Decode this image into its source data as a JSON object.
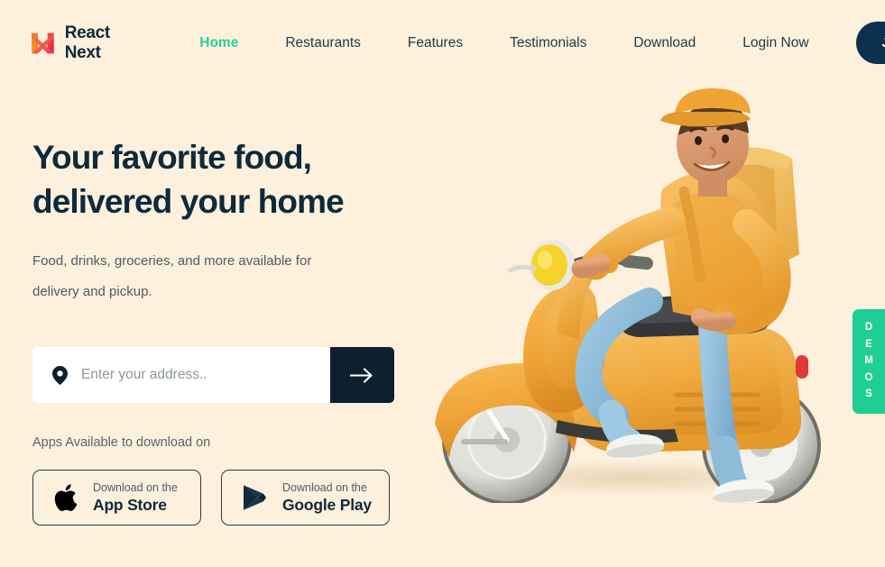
{
  "brand": {
    "name": "React Next",
    "logo_icon": "m-logo-icon",
    "logo_colors": [
      "#F9A031",
      "#F05A3C",
      "#E8254E"
    ]
  },
  "nav": {
    "links": [
      {
        "label": "Home",
        "active": true
      },
      {
        "label": "Restaurants",
        "active": false
      },
      {
        "label": "Features",
        "active": false
      },
      {
        "label": "Testimonials",
        "active": false
      },
      {
        "label": "Download",
        "active": false
      },
      {
        "label": "Login Now",
        "active": false
      }
    ],
    "cta_label": "Join Free"
  },
  "hero": {
    "headline_line1": "Your favorite food,",
    "headline_line2": "delivered your home",
    "subtext_line1": "Food, drinks, groceries, and more available for",
    "subtext_line2": "delivery and pickup.",
    "search": {
      "pin_icon": "location-pin-icon",
      "placeholder": "Enter your address..",
      "value": "",
      "submit_icon": "arrow-right-icon"
    },
    "apps_label": "Apps Available to download on",
    "stores": [
      {
        "icon": "apple-icon",
        "small": "Download on the",
        "big": "App Store"
      },
      {
        "icon": "google-play-icon",
        "small": "Download on the",
        "big": "Google Play"
      }
    ]
  },
  "illustration": {
    "alt": "3D delivery courier riding a yellow scooter with a delivery backpack"
  },
  "demos_tab": {
    "letters": [
      "D",
      "E",
      "M",
      "O",
      "S"
    ],
    "label": "DEMOS"
  },
  "colors": {
    "background": "#FDF0DC",
    "accent_green": "#25D196",
    "navy": "#0B3050",
    "dark_button": "#0E2030",
    "text_dark": "#0E2A3C",
    "text_muted": "#4C5C66",
    "scooter_yellow": "#F2A83B",
    "jeans_blue": "#86B9DA"
  }
}
